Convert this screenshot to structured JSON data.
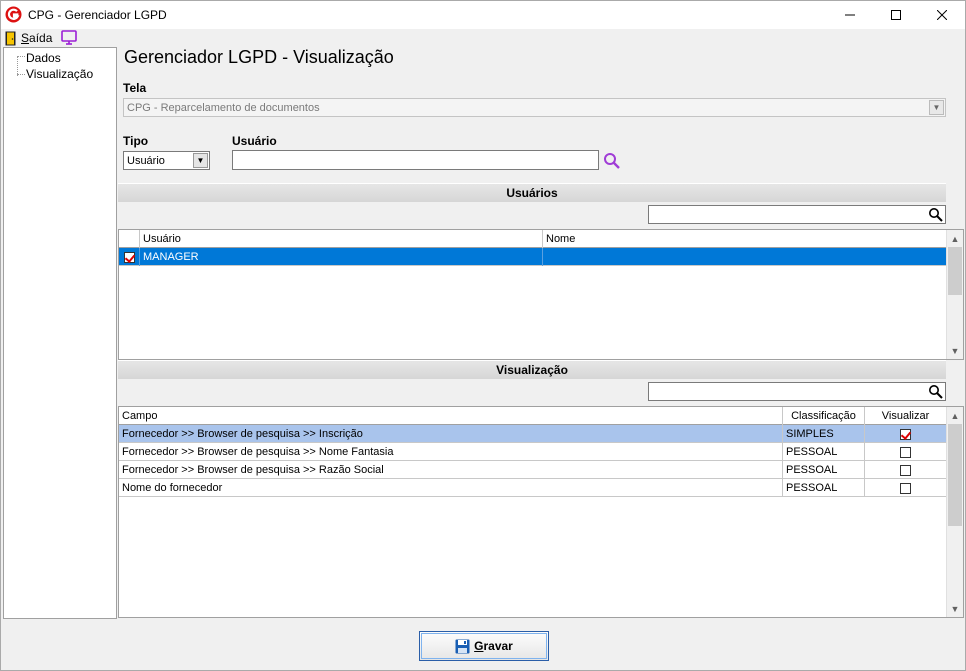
{
  "window": {
    "title": "CPG - Gerenciador LGPD"
  },
  "menu": {
    "exit_label": "Saída"
  },
  "tree": {
    "items": [
      "Dados",
      "Visualização"
    ]
  },
  "page": {
    "title": "Gerenciador LGPD - Visualização"
  },
  "form": {
    "tela_label": "Tela",
    "tela_value": "CPG - Reparcelamento de documentos",
    "tipo_label": "Tipo",
    "tipo_value": "Usuário",
    "usuario_label": "Usuário",
    "usuario_value": ""
  },
  "users_section": {
    "title": "Usuários",
    "filter_value": "",
    "columns": [
      "Usuário",
      "Nome"
    ],
    "rows": [
      {
        "checked": true,
        "usuario": "MANAGER",
        "nome": ""
      }
    ]
  },
  "view_section": {
    "title": "Visualização",
    "filter_value": "",
    "columns": [
      "Campo",
      "Classificação",
      "Visualizar"
    ],
    "rows": [
      {
        "campo": "Fornecedor >> Browser de pesquisa >> Inscrição",
        "classificacao": "SIMPLES",
        "visualizar": true
      },
      {
        "campo": "Fornecedor >> Browser de pesquisa >> Nome Fantasia",
        "classificacao": "PESSOAL",
        "visualizar": false
      },
      {
        "campo": "Fornecedor >> Browser de pesquisa >> Razão Social",
        "classificacao": "PESSOAL",
        "visualizar": false
      },
      {
        "campo": "Nome do fornecedor",
        "classificacao": "PESSOAL",
        "visualizar": false
      }
    ]
  },
  "actions": {
    "save_label": "Gravar"
  },
  "colors": {
    "selection": "#0078d7",
    "highlight": "#a9c4ec",
    "accent": "#2a5ea8"
  }
}
